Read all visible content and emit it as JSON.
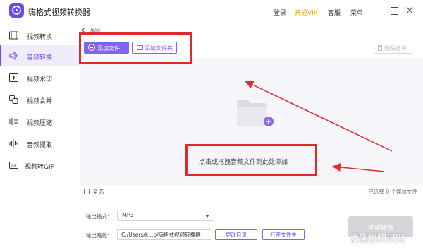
{
  "app": {
    "title": "嗨格式视频转换器"
  },
  "topbar": {
    "login": "登录",
    "vip": "开通VIP",
    "service": "客服",
    "menu": "菜单"
  },
  "sidebar": {
    "items": [
      {
        "label": "视频转换",
        "icon": "video-convert-icon"
      },
      {
        "label": "音频转换",
        "icon": "audio-convert-icon",
        "active": true
      },
      {
        "label": "视频水印",
        "icon": "watermark-icon"
      },
      {
        "label": "视频合并",
        "icon": "merge-icon"
      },
      {
        "label": "视频压缩",
        "icon": "compress-icon"
      },
      {
        "label": "音频提取",
        "icon": "audio-extract-icon"
      },
      {
        "label": "视频转GIF",
        "icon": "gif-icon"
      }
    ]
  },
  "content": {
    "back": "返回",
    "add_file": "添加文件",
    "add_folder": "添加文件夹",
    "clear_selected": "删除选中",
    "drop_hint": "点击或拖拽音频文件到此处添加",
    "select_all": "全选",
    "selected_info": "已选择 0 个媒体文件"
  },
  "output": {
    "format_label": "输出格式:",
    "format_value": "MP3",
    "path_label": "输出路径:",
    "path_value": "C:/Users/k...p/嗨格式视频转换器",
    "change_dir": "更改目录",
    "open_folder": "打开文件夹",
    "convert_all": "全部转换"
  },
  "watermark": "爱刨根知识网",
  "colors": {
    "accent": "#6b4de6",
    "annotation": "#e32a2a",
    "vip": "#f0a000"
  }
}
